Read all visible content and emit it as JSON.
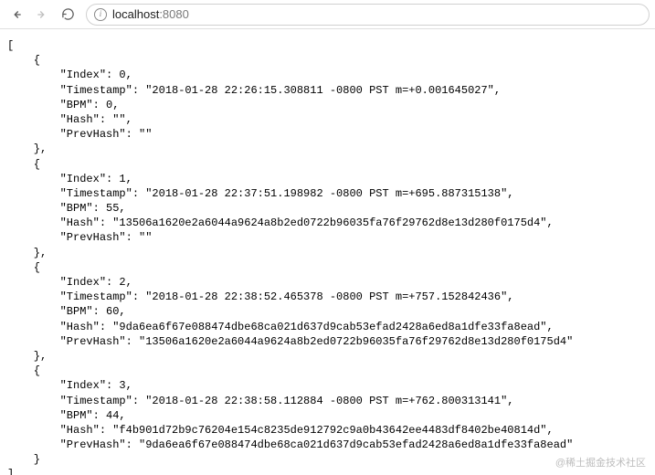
{
  "toolbar": {
    "back_label": "Back",
    "forward_label": "Forward",
    "reload_label": "Reload",
    "info_label": "Site information"
  },
  "url": {
    "host": "localhost",
    "port": ":8080"
  },
  "response": [
    {
      "Index": 0,
      "Timestamp": "2018-01-28 22:26:15.308811 -0800 PST m=+0.001645027",
      "BPM": 0,
      "Hash": "",
      "PrevHash": ""
    },
    {
      "Index": 1,
      "Timestamp": "2018-01-28 22:37:51.198982 -0800 PST m=+695.887315138",
      "BPM": 55,
      "Hash": "13506a1620e2a6044a9624a8b2ed0722b96035fa76f29762d8e13d280f0175d4",
      "PrevHash": ""
    },
    {
      "Index": 2,
      "Timestamp": "2018-01-28 22:38:52.465378 -0800 PST m=+757.152842436",
      "BPM": 60,
      "Hash": "9da6ea6f67e088474dbe68ca021d637d9cab53efad2428a6ed8a1dfe33fa8ead",
      "PrevHash": "13506a1620e2a6044a9624a8b2ed0722b96035fa76f29762d8e13d280f0175d4"
    },
    {
      "Index": 3,
      "Timestamp": "2018-01-28 22:38:58.112884 -0800 PST m=+762.800313141",
      "BPM": 44,
      "Hash": "f4b901d72b9c76204e154c8235de912792c9a0b43642ee4483df8402be40814d",
      "PrevHash": "9da6ea6f67e088474dbe68ca021d637d9cab53efad2428a6ed8a1dfe33fa8ead"
    }
  ],
  "watermark": "@稀土掘金技术社区"
}
